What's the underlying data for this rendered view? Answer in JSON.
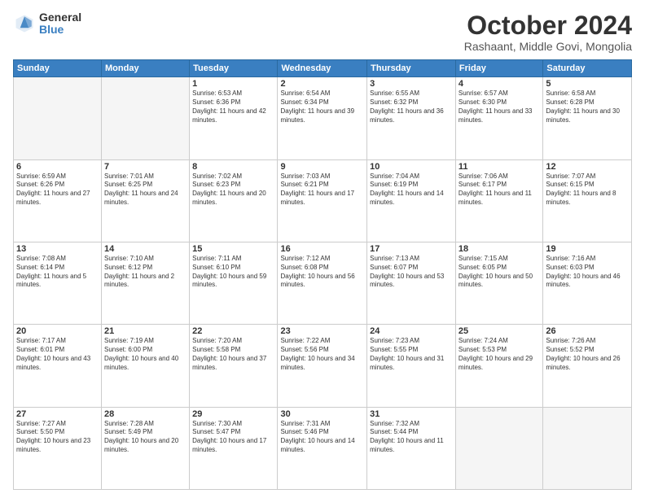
{
  "logo": {
    "general": "General",
    "blue": "Blue"
  },
  "header": {
    "month": "October 2024",
    "location": "Rashaant, Middle Govi, Mongolia"
  },
  "weekdays": [
    "Sunday",
    "Monday",
    "Tuesday",
    "Wednesday",
    "Thursday",
    "Friday",
    "Saturday"
  ],
  "weeks": [
    [
      {
        "day": "",
        "sunrise": "",
        "sunset": "",
        "daylight": ""
      },
      {
        "day": "",
        "sunrise": "",
        "sunset": "",
        "daylight": ""
      },
      {
        "day": "1",
        "sunrise": "Sunrise: 6:53 AM",
        "sunset": "Sunset: 6:36 PM",
        "daylight": "Daylight: 11 hours and 42 minutes."
      },
      {
        "day": "2",
        "sunrise": "Sunrise: 6:54 AM",
        "sunset": "Sunset: 6:34 PM",
        "daylight": "Daylight: 11 hours and 39 minutes."
      },
      {
        "day": "3",
        "sunrise": "Sunrise: 6:55 AM",
        "sunset": "Sunset: 6:32 PM",
        "daylight": "Daylight: 11 hours and 36 minutes."
      },
      {
        "day": "4",
        "sunrise": "Sunrise: 6:57 AM",
        "sunset": "Sunset: 6:30 PM",
        "daylight": "Daylight: 11 hours and 33 minutes."
      },
      {
        "day": "5",
        "sunrise": "Sunrise: 6:58 AM",
        "sunset": "Sunset: 6:28 PM",
        "daylight": "Daylight: 11 hours and 30 minutes."
      }
    ],
    [
      {
        "day": "6",
        "sunrise": "Sunrise: 6:59 AM",
        "sunset": "Sunset: 6:26 PM",
        "daylight": "Daylight: 11 hours and 27 minutes."
      },
      {
        "day": "7",
        "sunrise": "Sunrise: 7:01 AM",
        "sunset": "Sunset: 6:25 PM",
        "daylight": "Daylight: 11 hours and 24 minutes."
      },
      {
        "day": "8",
        "sunrise": "Sunrise: 7:02 AM",
        "sunset": "Sunset: 6:23 PM",
        "daylight": "Daylight: 11 hours and 20 minutes."
      },
      {
        "day": "9",
        "sunrise": "Sunrise: 7:03 AM",
        "sunset": "Sunset: 6:21 PM",
        "daylight": "Daylight: 11 hours and 17 minutes."
      },
      {
        "day": "10",
        "sunrise": "Sunrise: 7:04 AM",
        "sunset": "Sunset: 6:19 PM",
        "daylight": "Daylight: 11 hours and 14 minutes."
      },
      {
        "day": "11",
        "sunrise": "Sunrise: 7:06 AM",
        "sunset": "Sunset: 6:17 PM",
        "daylight": "Daylight: 11 hours and 11 minutes."
      },
      {
        "day": "12",
        "sunrise": "Sunrise: 7:07 AM",
        "sunset": "Sunset: 6:15 PM",
        "daylight": "Daylight: 11 hours and 8 minutes."
      }
    ],
    [
      {
        "day": "13",
        "sunrise": "Sunrise: 7:08 AM",
        "sunset": "Sunset: 6:14 PM",
        "daylight": "Daylight: 11 hours and 5 minutes."
      },
      {
        "day": "14",
        "sunrise": "Sunrise: 7:10 AM",
        "sunset": "Sunset: 6:12 PM",
        "daylight": "Daylight: 11 hours and 2 minutes."
      },
      {
        "day": "15",
        "sunrise": "Sunrise: 7:11 AM",
        "sunset": "Sunset: 6:10 PM",
        "daylight": "Daylight: 10 hours and 59 minutes."
      },
      {
        "day": "16",
        "sunrise": "Sunrise: 7:12 AM",
        "sunset": "Sunset: 6:08 PM",
        "daylight": "Daylight: 10 hours and 56 minutes."
      },
      {
        "day": "17",
        "sunrise": "Sunrise: 7:13 AM",
        "sunset": "Sunset: 6:07 PM",
        "daylight": "Daylight: 10 hours and 53 minutes."
      },
      {
        "day": "18",
        "sunrise": "Sunrise: 7:15 AM",
        "sunset": "Sunset: 6:05 PM",
        "daylight": "Daylight: 10 hours and 50 minutes."
      },
      {
        "day": "19",
        "sunrise": "Sunrise: 7:16 AM",
        "sunset": "Sunset: 6:03 PM",
        "daylight": "Daylight: 10 hours and 46 minutes."
      }
    ],
    [
      {
        "day": "20",
        "sunrise": "Sunrise: 7:17 AM",
        "sunset": "Sunset: 6:01 PM",
        "daylight": "Daylight: 10 hours and 43 minutes."
      },
      {
        "day": "21",
        "sunrise": "Sunrise: 7:19 AM",
        "sunset": "Sunset: 6:00 PM",
        "daylight": "Daylight: 10 hours and 40 minutes."
      },
      {
        "day": "22",
        "sunrise": "Sunrise: 7:20 AM",
        "sunset": "Sunset: 5:58 PM",
        "daylight": "Daylight: 10 hours and 37 minutes."
      },
      {
        "day": "23",
        "sunrise": "Sunrise: 7:22 AM",
        "sunset": "Sunset: 5:56 PM",
        "daylight": "Daylight: 10 hours and 34 minutes."
      },
      {
        "day": "24",
        "sunrise": "Sunrise: 7:23 AM",
        "sunset": "Sunset: 5:55 PM",
        "daylight": "Daylight: 10 hours and 31 minutes."
      },
      {
        "day": "25",
        "sunrise": "Sunrise: 7:24 AM",
        "sunset": "Sunset: 5:53 PM",
        "daylight": "Daylight: 10 hours and 29 minutes."
      },
      {
        "day": "26",
        "sunrise": "Sunrise: 7:26 AM",
        "sunset": "Sunset: 5:52 PM",
        "daylight": "Daylight: 10 hours and 26 minutes."
      }
    ],
    [
      {
        "day": "27",
        "sunrise": "Sunrise: 7:27 AM",
        "sunset": "Sunset: 5:50 PM",
        "daylight": "Daylight: 10 hours and 23 minutes."
      },
      {
        "day": "28",
        "sunrise": "Sunrise: 7:28 AM",
        "sunset": "Sunset: 5:49 PM",
        "daylight": "Daylight: 10 hours and 20 minutes."
      },
      {
        "day": "29",
        "sunrise": "Sunrise: 7:30 AM",
        "sunset": "Sunset: 5:47 PM",
        "daylight": "Daylight: 10 hours and 17 minutes."
      },
      {
        "day": "30",
        "sunrise": "Sunrise: 7:31 AM",
        "sunset": "Sunset: 5:46 PM",
        "daylight": "Daylight: 10 hours and 14 minutes."
      },
      {
        "day": "31",
        "sunrise": "Sunrise: 7:32 AM",
        "sunset": "Sunset: 5:44 PM",
        "daylight": "Daylight: 10 hours and 11 minutes."
      },
      {
        "day": "",
        "sunrise": "",
        "sunset": "",
        "daylight": ""
      },
      {
        "day": "",
        "sunrise": "",
        "sunset": "",
        "daylight": ""
      }
    ]
  ]
}
